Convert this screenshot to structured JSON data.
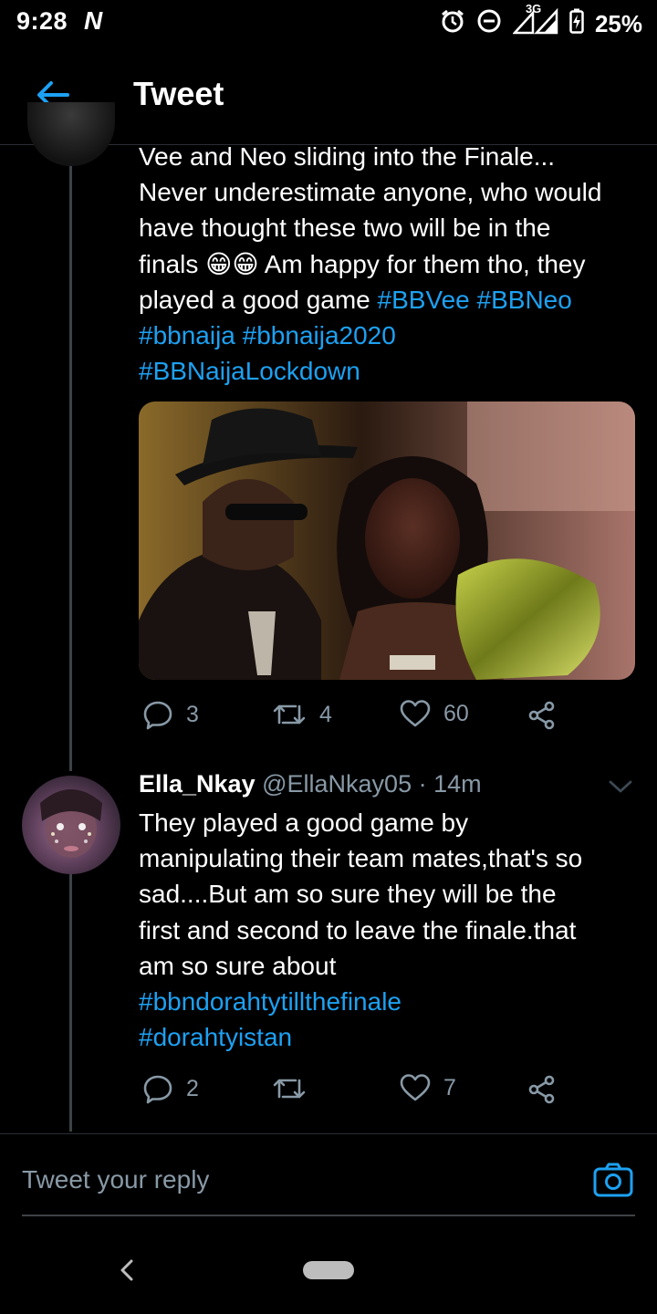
{
  "status_bar": {
    "time": "9:28",
    "carrier_glyph": "N",
    "network": "3G",
    "battery": "25%"
  },
  "header": {
    "title": "Tweet"
  },
  "tweet": {
    "text_line1": "Vee and Neo sliding into the Finale...",
    "text_line2": "Never underestimate anyone, who would",
    "text_line3": "have thought these two will be in the",
    "text_line4a": "finals 😁😁 Am happy for them tho, they",
    "text_line5a": "played a good game ",
    "hashtags": {
      "bbvee": "#BBVee",
      "bbneo": "#BBNeo",
      "bbnaija": "#bbnaija",
      "bbnaija2020": "#bbnaija2020",
      "bbnaijalockdown": "#BBNaijaLockdown"
    },
    "replies": "3",
    "retweets": "4",
    "likes": "60"
  },
  "reply": {
    "name": "Ella_Nkay",
    "handle": "@EllaNkay05",
    "separator": "·",
    "time": "14m",
    "line1": "They played a good game by",
    "line2": "manipulating their team mates,that's so",
    "line3": "sad....But am so sure they will be the",
    "line4": "first and second to leave the finale.that",
    "line5": "am so sure about",
    "hashtag1": "#bbndorahtytillthefinale",
    "hashtag2": "#dorahtyistan",
    "replies": "2",
    "retweets": "",
    "likes": "7"
  },
  "reply_box": {
    "placeholder": "Tweet your reply"
  },
  "colors": {
    "accent": "#1da1f2",
    "muted": "#8899a6",
    "background": "#000000"
  }
}
